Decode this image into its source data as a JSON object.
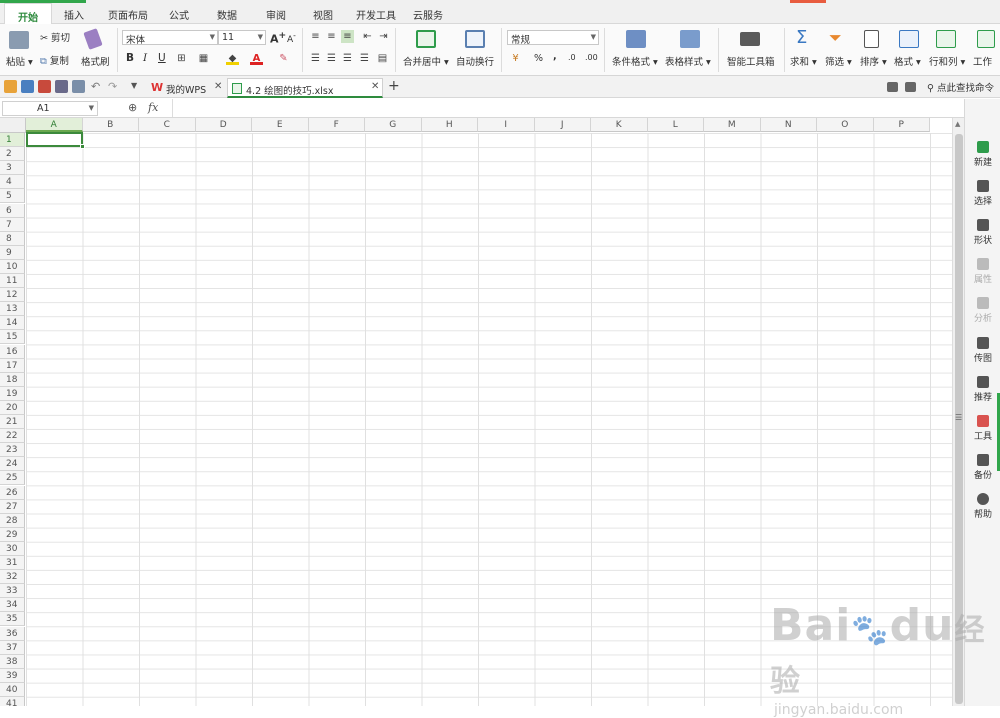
{
  "menu_tabs": [
    "开始",
    "插入",
    "页面布局",
    "公式",
    "数据",
    "审阅",
    "视图",
    "开发工具",
    "云服务"
  ],
  "ribbon": {
    "paste": "粘贴",
    "cut": "剪切",
    "copy": "复制",
    "format_painter": "格式刷",
    "font_name": "宋体",
    "font_size": "11",
    "bold": "B",
    "italic": "I",
    "underline": "U",
    "grow_font": "A",
    "shrink_font": "A",
    "merge_center": "合并居中",
    "wrap_text": "自动换行",
    "number_format": "常规",
    "percent": "%",
    "comma": ",",
    "inc_decimal": ".0",
    "dec_decimal": ".00",
    "conditional_format": "条件格式",
    "table_style": "表格样式",
    "smart_toolbox": "智能工具箱",
    "sum": "求和",
    "filter": "筛选",
    "sort": "排序",
    "format": "格式",
    "row_col": "行和列",
    "worksheet": "工作"
  },
  "doc_tabs": {
    "my_wps": "我的WPS",
    "active_file": "4.2 绘图的技巧.xlsx",
    "add": "+",
    "search_label": "点此查找命令"
  },
  "formula_bar": {
    "name_box": "A1",
    "fx": "fx",
    "value": ""
  },
  "columns": [
    "A",
    "B",
    "C",
    "D",
    "E",
    "F",
    "G",
    "H",
    "I",
    "J",
    "K",
    "L",
    "M",
    "N",
    "O",
    "P"
  ],
  "rows": [
    "1",
    "2",
    "3",
    "4",
    "5",
    "6",
    "7",
    "8",
    "9",
    "10",
    "11",
    "12",
    "13",
    "14",
    "15",
    "16",
    "17",
    "18",
    "19",
    "20",
    "21",
    "22",
    "23",
    "24",
    "25",
    "26",
    "27",
    "28",
    "29",
    "30",
    "31",
    "32",
    "33",
    "34",
    "35",
    "36",
    "37",
    "38",
    "39",
    "40",
    "41"
  ],
  "selected_cell": "A1",
  "right_panel": [
    {
      "label": "新建",
      "icon": "new-icon",
      "color": "#2e9c4b",
      "dim": false
    },
    {
      "label": "选择",
      "icon": "select-icon",
      "color": "#555555",
      "dim": false
    },
    {
      "label": "形状",
      "icon": "shape-icon",
      "color": "#555555",
      "dim": false
    },
    {
      "label": "属性",
      "icon": "property-icon",
      "color": "#bbbbbb",
      "dim": true
    },
    {
      "label": "分析",
      "icon": "analyze-icon",
      "color": "#bbbbbb",
      "dim": true
    },
    {
      "label": "传图",
      "icon": "upload-image-icon",
      "color": "#555555",
      "dim": false
    },
    {
      "label": "推荐",
      "icon": "recommend-icon",
      "color": "#555555",
      "dim": false
    },
    {
      "label": "工具",
      "icon": "tool-icon",
      "color": "#d9534f",
      "dim": false
    },
    {
      "label": "备份",
      "icon": "backup-icon",
      "color": "#555555",
      "dim": false
    },
    {
      "label": "帮助",
      "icon": "help-icon",
      "color": "#555555",
      "dim": false
    }
  ],
  "watermark": {
    "brand": "Bai",
    "brand2": "du",
    "cn": "经验",
    "url": "jingyan.baidu.com"
  }
}
